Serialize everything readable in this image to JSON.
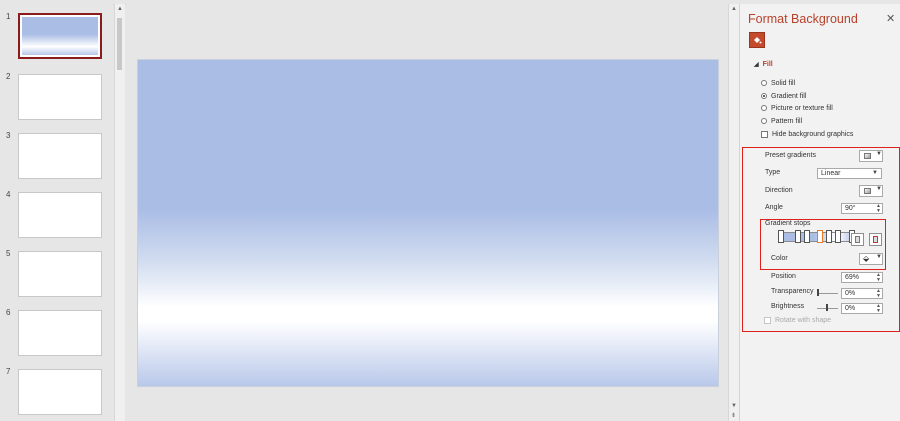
{
  "thumbnails": [
    {
      "number": "1",
      "selected": true
    },
    {
      "number": "2",
      "selected": false
    },
    {
      "number": "3",
      "selected": false
    },
    {
      "number": "4",
      "selected": false
    },
    {
      "number": "5",
      "selected": false
    },
    {
      "number": "6",
      "selected": false
    },
    {
      "number": "7",
      "selected": false
    }
  ],
  "panel": {
    "title": "Format Background",
    "close_glyph": "✕",
    "section_title": "Fill",
    "fill_options": [
      {
        "label": "Solid fill",
        "selected": false
      },
      {
        "label": "Gradient fill",
        "selected": true
      },
      {
        "label": "Picture or texture fill",
        "selected": false
      },
      {
        "label": "Pattern fill",
        "selected": false
      }
    ],
    "hide_background_graphics": {
      "label": "Hide background graphics",
      "checked": false
    },
    "preset_gradients_label": "Preset gradients",
    "type_label": "Type",
    "type_value": "Linear",
    "direction_label": "Direction",
    "angle_label": "Angle",
    "angle_value": "90°",
    "gradient_stops_label": "Gradient stops",
    "color_label": "Color",
    "position_label": "Position",
    "position_value": "69%",
    "transparency_label": "Transparency",
    "transparency_value": "0%",
    "brightness_label": "Brightness",
    "brightness_value": "0%",
    "rotate_with_shape_label": "Rotate with shape"
  },
  "colors": {
    "accent": "#b8412a",
    "highlight_box": "#e0201b",
    "gradient_top": "#aabde5",
    "gradient_mid": "#ffffff",
    "gradient_bottom": "#b9c8ea"
  }
}
